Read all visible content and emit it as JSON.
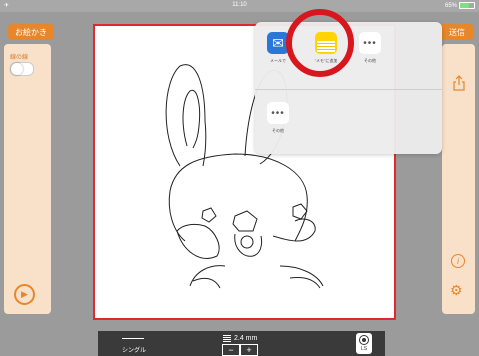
{
  "status": {
    "left": "✈",
    "time": "11:10",
    "battery": "65%",
    "battery_level": 0.64
  },
  "left_panel": {
    "title_button": "お絵かき",
    "toggle_label": "線の線",
    "toggle_on": false,
    "play_icon": "play-icon"
  },
  "right_panel": {
    "send_button": "送信",
    "share_icon": "share-icon",
    "info_icon": "info-icon",
    "settings_icon": "gear-icon"
  },
  "share_sheet": {
    "row1": [
      {
        "label": "メールで",
        "icon": "mail-icon"
      },
      {
        "label": "\"メモ\"に追加",
        "icon": "notes-icon"
      },
      {
        "label": "その他",
        "icon": "more-icon"
      }
    ],
    "row2": [
      {
        "label": "その他",
        "icon": "more-icon"
      }
    ]
  },
  "bottom_bar": {
    "line_type": "シングル",
    "size": "2.4 mm",
    "minus": "−",
    "plus": "+",
    "mode": "LS"
  },
  "colors": {
    "accent": "#e8862a",
    "canvas_border": "#e02a2a",
    "highlight_ring": "#d8161e",
    "panel": "#f8e1c8"
  }
}
